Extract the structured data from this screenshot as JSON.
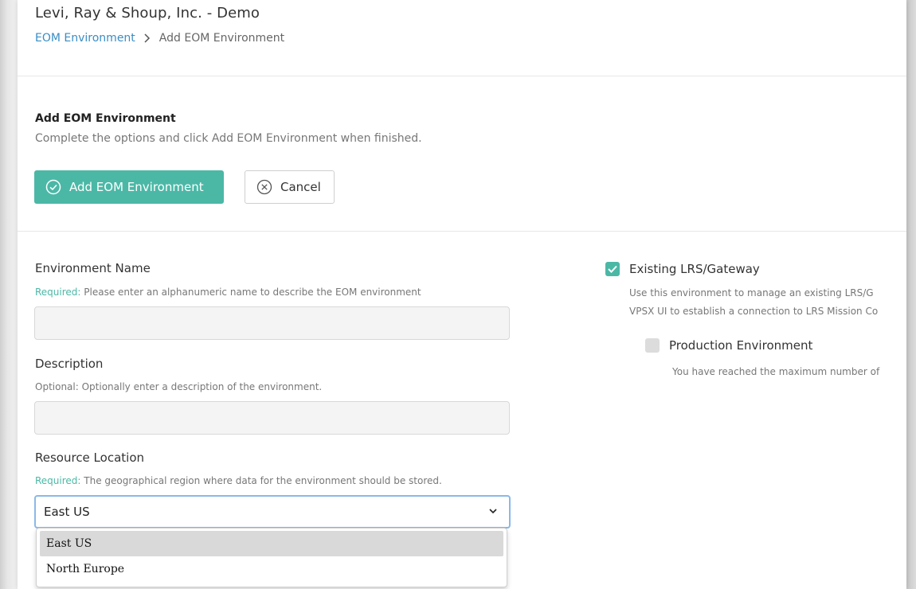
{
  "header": {
    "org_title": "Levi, Ray & Shoup, Inc. - Demo",
    "breadcrumb": [
      "EOM Environment",
      "Add EOM Environment"
    ]
  },
  "section": {
    "title": "Add EOM Environment",
    "subtitle": "Complete the options and click Add EOM Environment when finished."
  },
  "actions": {
    "add_label": "Add EOM Environment",
    "cancel_label": "Cancel"
  },
  "form": {
    "env_name": {
      "label": "Environment Name",
      "required_tag": "Required:",
      "help": " Please enter an alphanumeric name to describe the EOM environment",
      "value": ""
    },
    "description": {
      "label": "Description",
      "help": "Optional: Optionally enter a description of the environment.",
      "value": ""
    },
    "resource_location": {
      "label": "Resource Location",
      "required_tag": "Required:",
      "help": " The geographical region where data for the environment should be stored.",
      "selected": "East US",
      "options": [
        "East US",
        "North Europe"
      ]
    }
  },
  "options": {
    "existing_lrs": {
      "label": "Existing LRS/Gateway",
      "checked": true,
      "help_line1": "Use this environment to manage an existing LRS/G",
      "help_line2": "VPSX UI to establish a connection to LRS Mission Co"
    },
    "production": {
      "label": "Production Environment",
      "checked": false,
      "help": "You have reached the maximum number of"
    }
  },
  "colors": {
    "accent": "#4bb8a6",
    "link": "#3a8dc4",
    "focus": "#8ab8e8"
  }
}
